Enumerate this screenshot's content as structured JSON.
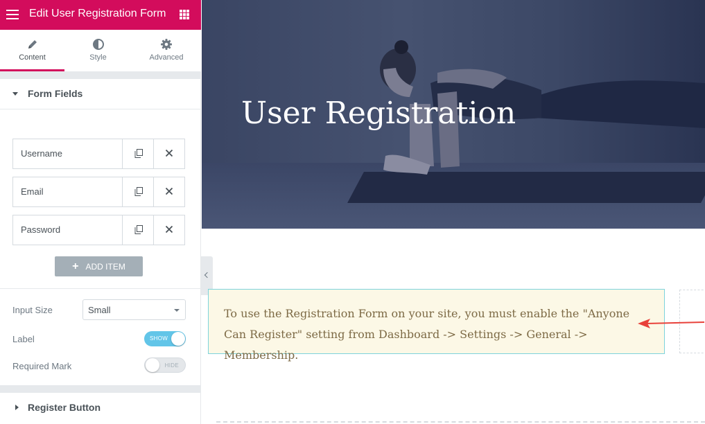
{
  "topbar": {
    "title": "Edit User Registration Form"
  },
  "tabs": [
    {
      "label": "Content",
      "icon": "pencil-icon"
    },
    {
      "label": "Style",
      "icon": "half-circle-icon"
    },
    {
      "label": "Advanced",
      "icon": "gear-icon"
    }
  ],
  "form_fields": {
    "title": "Form Fields",
    "items": [
      {
        "label": "Username"
      },
      {
        "label": "Email"
      },
      {
        "label": "Password"
      }
    ],
    "add_item_label": "ADD ITEM"
  },
  "controls": {
    "input_size": {
      "label": "Input Size",
      "value": "Small"
    },
    "label_toggle": {
      "label": "Label",
      "state": "SHOW"
    },
    "required_mark": {
      "label": "Required Mark",
      "state": "HIDE"
    }
  },
  "register_button_section": {
    "title": "Register Button"
  },
  "hero": {
    "title": "User Registration"
  },
  "notice": {
    "text": "To use the Registration Form on your site, you must enable the \"Anyone Can Register\" setting from Dashboard -> Settings -> General -> Membership."
  },
  "colors": {
    "accent": "#d30c5c",
    "toggle_on": "#62c5e8",
    "notice_bg": "#fcf8e6",
    "notice_border": "#7cd3dc",
    "arrow": "#e8413a"
  }
}
